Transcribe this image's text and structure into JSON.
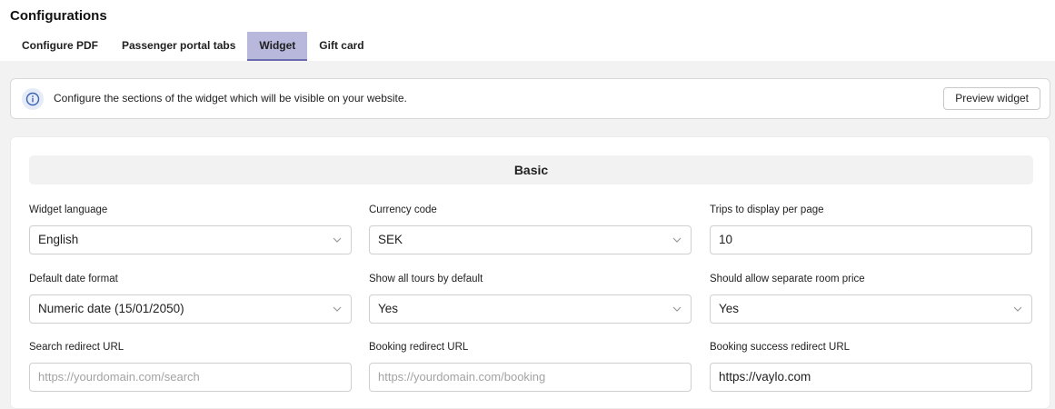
{
  "page": {
    "title": "Configurations"
  },
  "tabs": [
    {
      "label": "Configure PDF"
    },
    {
      "label": "Passenger portal tabs"
    },
    {
      "label": "Widget"
    },
    {
      "label": "Gift card"
    }
  ],
  "info": {
    "text": "Configure the sections of the widget which will be visible on your website.",
    "preview_button": "Preview widget"
  },
  "section": {
    "title": "Basic"
  },
  "fields": {
    "widget_language": {
      "label": "Widget language",
      "value": "English"
    },
    "currency_code": {
      "label": "Currency code",
      "value": "SEK"
    },
    "trips_per_page": {
      "label": "Trips to display per page",
      "value": "10"
    },
    "date_format": {
      "label": "Default date format",
      "value": "Numeric date (15/01/2050)"
    },
    "show_all_tours": {
      "label": "Show all tours by default",
      "value": "Yes"
    },
    "separate_room_price": {
      "label": "Should allow separate room price",
      "value": "Yes"
    },
    "search_redirect": {
      "label": "Search redirect URL",
      "placeholder": "https://yourdomain.com/search",
      "value": ""
    },
    "booking_redirect": {
      "label": "Booking redirect URL",
      "placeholder": "https://yourdomain.com/booking",
      "value": ""
    },
    "booking_success_redirect": {
      "label": "Booking success redirect URL",
      "value": "https://vaylo.com"
    }
  },
  "colors": {
    "active_tab": "#b8b8dc",
    "info_icon": "#3a62b8"
  }
}
